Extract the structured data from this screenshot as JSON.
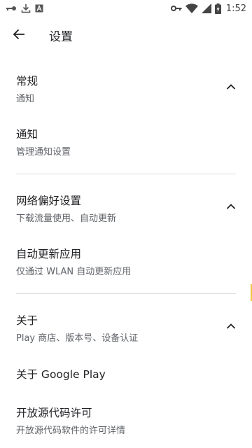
{
  "status_bar": {
    "time": "1:52",
    "icons": [
      "key-icon",
      "download-icon",
      "app-notification-icon",
      "vpn-key-icon",
      "wifi-icon",
      "cell-signal-icon",
      "battery-charging-icon"
    ]
  },
  "app_bar": {
    "title": "设置",
    "back_icon": "arrow-back-icon"
  },
  "sections": [
    {
      "header": {
        "title": "常规",
        "summary": "通知",
        "expanded": true
      },
      "items": [
        {
          "title": "通知",
          "summary": "管理通知设置"
        }
      ]
    },
    {
      "header": {
        "title": "网络偏好设置",
        "summary": "下载流量使用、自动更新",
        "expanded": true
      },
      "items": [
        {
          "title": "自动更新应用",
          "summary": "仅通过 WLAN 自动更新应用"
        }
      ]
    },
    {
      "header": {
        "title": "关于",
        "summary": "Play 商店、版本号、设备认证",
        "expanded": true
      },
      "items": [
        {
          "title": "关于 Google Play",
          "summary": ""
        },
        {
          "title": "开放源代码许可",
          "summary": "开放源代码软件的许可详情"
        }
      ]
    }
  ],
  "colors": {
    "background": "#ffffff",
    "title_text": "#202124",
    "summary_text": "#5f6368",
    "divider": "#dadce0",
    "scroll_indicator": "#f4c542"
  }
}
